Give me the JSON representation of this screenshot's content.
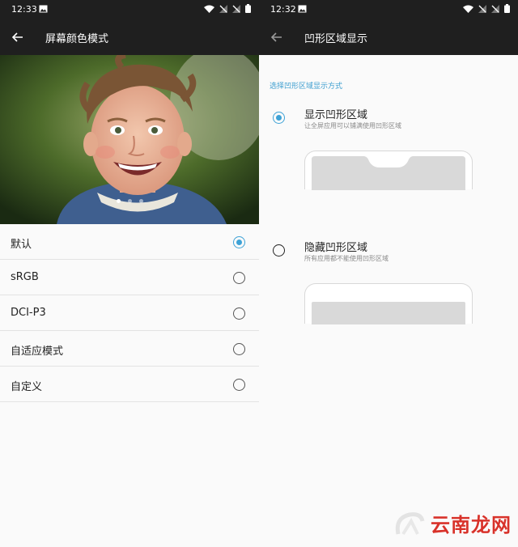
{
  "left": {
    "status": {
      "time": "12:33"
    },
    "appbar": {
      "title": "屏幕颜色模式"
    },
    "modes": [
      {
        "label": "默认",
        "checked": true
      },
      {
        "label": "sRGB",
        "checked": false
      },
      {
        "label": "DCI-P3",
        "checked": false
      },
      {
        "label": "自适应模式",
        "checked": false
      },
      {
        "label": "自定义",
        "checked": false
      }
    ],
    "carousel": {
      "pages": 3,
      "active": 1
    }
  },
  "right": {
    "status": {
      "time": "12:32"
    },
    "appbar": {
      "title": "凹形区域显示"
    },
    "section_header": "选择凹形区域显示方式",
    "options": [
      {
        "title": "显示凹形区域",
        "subtitle": "让全屏应用可以铺满使用凹形区域",
        "checked": true
      },
      {
        "title": "隐藏凹形区域",
        "subtitle": "所有应用都不能使用凹形区域",
        "checked": false
      }
    ]
  },
  "watermark": {
    "text": "云南龙网"
  },
  "colors": {
    "accent": "#3ea2d6",
    "appbar": "#1f1f1f",
    "watermark": "#d8322a"
  }
}
